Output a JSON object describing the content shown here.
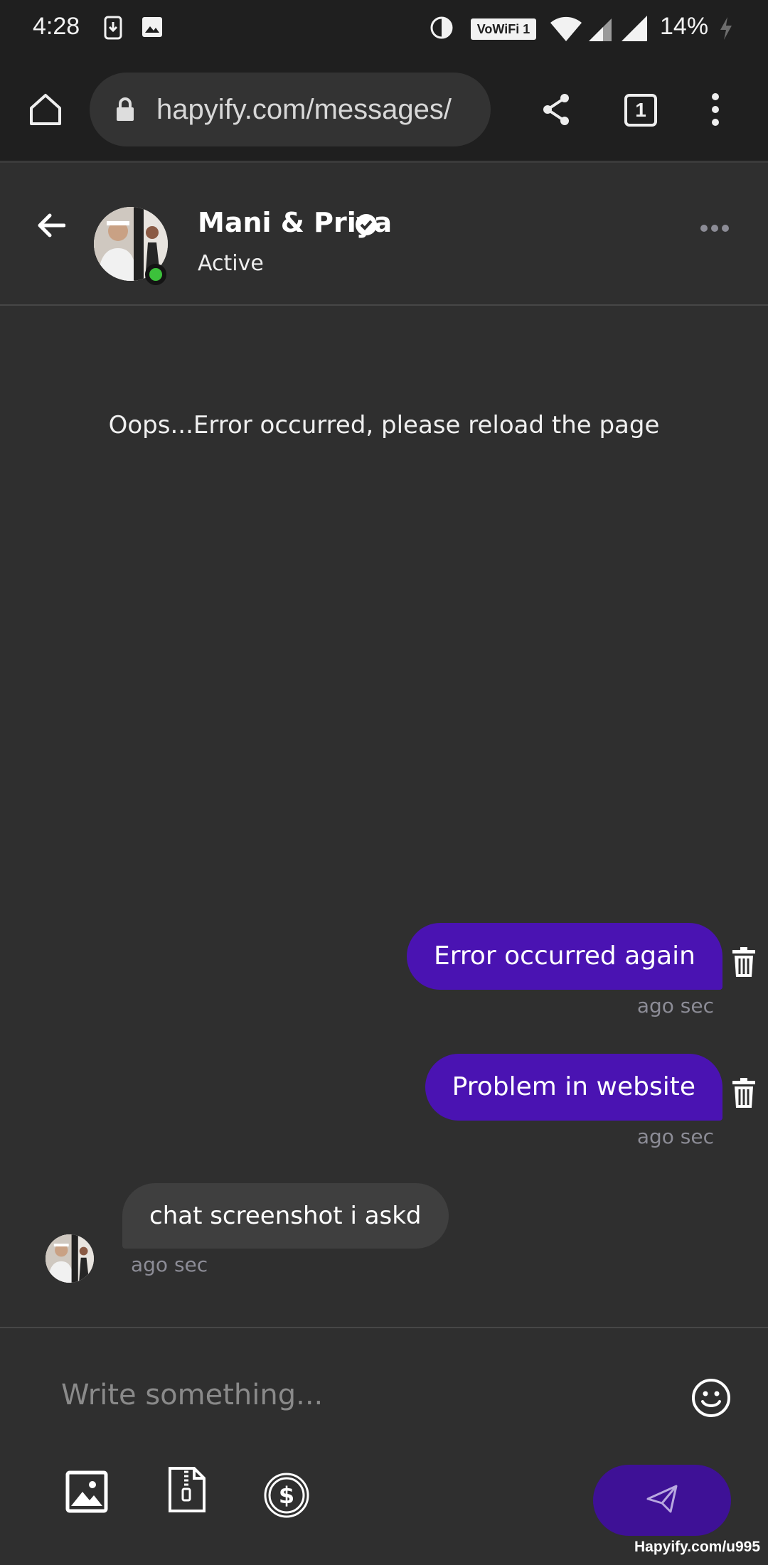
{
  "status_bar": {
    "time": "4:28",
    "wifi_badge": "VoWiFi 1",
    "battery": "14%"
  },
  "browser": {
    "url": "hapyify.com/messages/",
    "tab_count": "1"
  },
  "chat": {
    "contact_name": "Mani & Priya",
    "contact_status": "Active"
  },
  "messages": {
    "error_text": "Oops...Error occurred, please reload the page",
    "items": [
      {
        "direction": "outgoing",
        "text": "Error occurred again",
        "time": "ago sec"
      },
      {
        "direction": "outgoing",
        "text": "Problem in website",
        "time": "ago sec"
      },
      {
        "direction": "incoming",
        "text": "chat screenshot i askd",
        "time": "ago sec"
      }
    ]
  },
  "composer": {
    "placeholder": "Write something..."
  },
  "watermark": "Hapyify.com/u995",
  "colors": {
    "background": "#2f2f2f",
    "outgoing_bubble": "#4a13b2",
    "incoming_bubble": "#3f3f3f",
    "send_button": "#3e1196",
    "online": "#3cc13b"
  }
}
